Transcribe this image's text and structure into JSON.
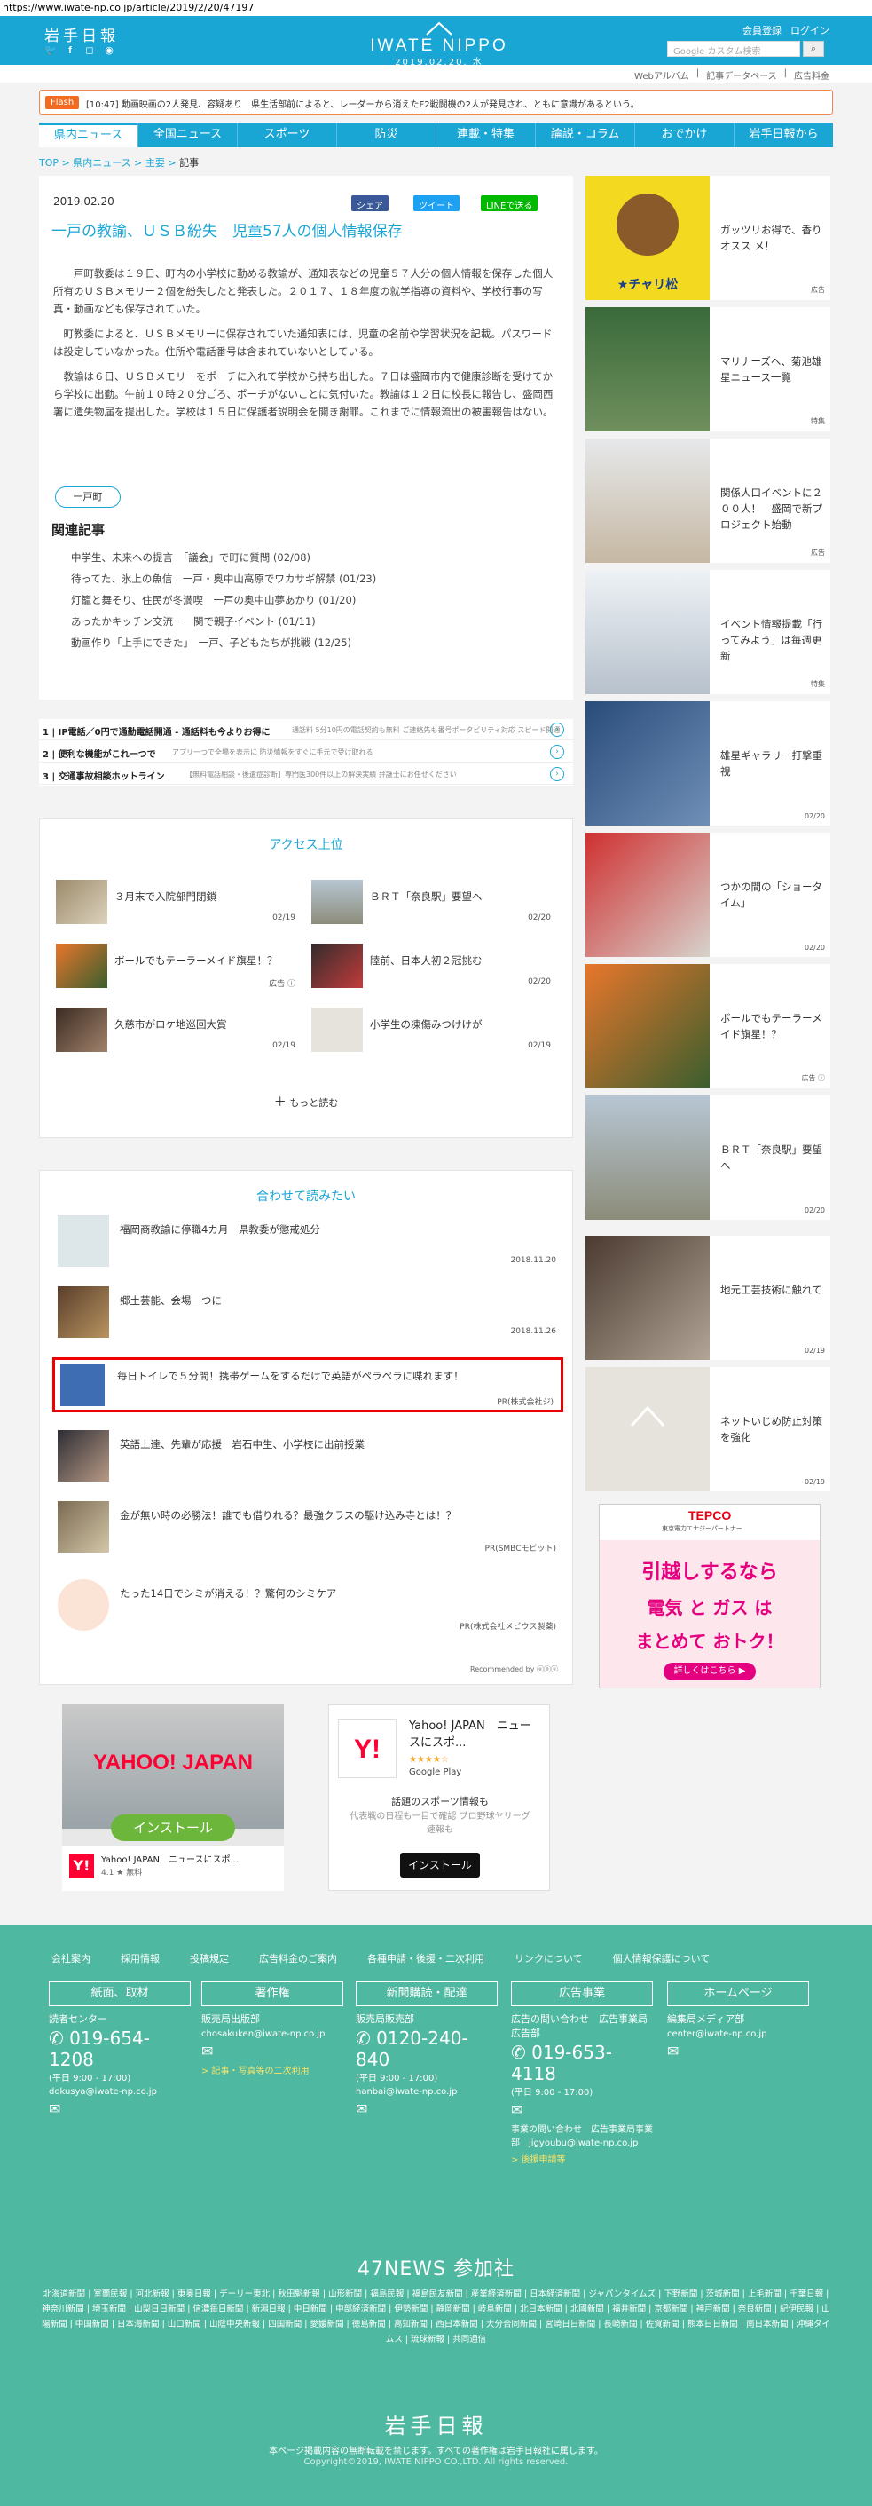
{
  "url": "https://www.iwate-np.co.jp/article/2019/2/20/47197",
  "header": {
    "logo_jp": "岩手日報",
    "brand": "IWATE NIPPO",
    "date": "2019.02.20. 水",
    "links": [
      "会員登録",
      "ログイン"
    ],
    "search_placeholder": "Google カスタム検索",
    "sub_links": [
      "Webアルバム",
      "記事データベース",
      "広告料金"
    ]
  },
  "flash": {
    "label": "Flash",
    "text": "[10:47] 動画映画の2人発見、容疑あり　県生活部前によると、レーダーから消えたF2戦闘機の2人が発見され、ともに意識があるという。"
  },
  "nav": [
    "県内ニュース",
    "全国ニュース",
    "スポーツ",
    "防災",
    "連載・特集",
    "論説・コラム",
    "おでかけ",
    "岩手日報から"
  ],
  "breadcrumb": [
    "TOP",
    "県内ニュース",
    "主要",
    "記事"
  ],
  "article": {
    "date": "2019.02.20",
    "share": [
      "シェア",
      "ツイート",
      "LINEで送る"
    ],
    "title": "一戸の教諭、ＵＳＢ紛失　児童57人の個人情報保存",
    "paragraphs": [
      "一戸町教委は１９日、町内の小学校に勤める教諭が、通知表などの児童５７人分の個人情報を保存した個人所有のＵＳＢメモリー２個を紛失したと発表した。２０１７、１８年度の就学指導の資料や、学校行事の写真・動画なども保存されていた。",
      "町教委によると、ＵＳＢメモリーに保存されていた通知表には、児童の名前や学習状況を記載。パスワードは設定していなかった。住所や電話番号は含まれていないとしている。",
      "教諭は６日、ＵＳＢメモリーをポーチに入れて学校から持ち出した。７日は盛岡市内で健康診断を受けてから学校に出勤。午前１０時２０分ごろ、ポーチがないことに気付いた。教諭は１２日に校長に報告し、盛岡西署に遺失物届を提出した。学校は１５日に保護者説明会を開き謝罪。これまでに情報流出の被害報告はない。"
    ],
    "tag": "一戸町",
    "related_heading": "関連記事",
    "related": [
      "中学生、未来への提言　「議会」で町に質問 (02/08)",
      "待ってた、氷上の魚信　一戸・奥中山高原でワカサギ解禁 (01/23)",
      "灯籠と舞そり、住民が冬満喫　一戸の奥中山夢あかり (01/20)",
      "あったかキッチン交流　一関で親子イベント (01/11)",
      "動画作り「上手にできた」　一戸、子どもたちが挑戦 (12/25)"
    ]
  },
  "ads_text": [
    {
      "num": "1",
      "title": "IP電話／0円で通勤電話開通 - 通話料も今よりお得に",
      "desc": "通話料 5分10円の電話契約も無料 ご連絡先も番号ポータビリティ対応 スピード開通"
    },
    {
      "num": "2",
      "title": "便利な機能がこれ一つで",
      "desc": "アプリ一つで全場を表示に 防災情報をすぐに手元で受け取れる"
    },
    {
      "num": "3",
      "title": "交通事故相談ホットライン",
      "desc": "【無料電話相談・後遺症診断】専門医300件以上の解決実績 弁護士にお任せください"
    }
  ],
  "ranking": {
    "heading": "アクセス上位",
    "items": [
      {
        "title": "３月末で入院部門閉鎖",
        "date": "02/19"
      },
      {
        "title": "ＢＲＴ「奈良駅」要望へ",
        "date": "02/20"
      },
      {
        "title": "ボールでもテーラーメイド旗星！？",
        "date": "広告 ⓘ"
      },
      {
        "title": "陸前、日本人初２冠挑む",
        "date": "02/20"
      },
      {
        "title": "久慈市がロケ地巡回大賞",
        "date": "02/19"
      },
      {
        "title": "小学生の凍傷みつけけが",
        "date": "02/19"
      }
    ],
    "more": "もっと読む"
  },
  "recommend": {
    "heading": "合わせて読みたい",
    "items": [
      {
        "title": "福岡商教諭に停職4カ月　県教委が懲戒処分",
        "date": "2018.11.20"
      },
      {
        "title": "郷土芸能、会場一つに",
        "date": "2018.11.26"
      },
      {
        "title": "毎日トイレで５分間！携帯ゲームをするだけで英語がペラペラに喋れます！",
        "date": "PR(株式会社ジ)"
      },
      {
        "title": "英語上達、先輩が応援　岩石中生、小学校に出前授業",
        "date": ""
      },
      {
        "title": "金が無い時の必勝法！誰でも借りれる？最強クラスの駆け込み寺とは！？",
        "date": "PR(SMBCモビット)"
      },
      {
        "title": "たった14日でシミが消える！？驚何のシミケア",
        "date": "PR(株式会社メビウス製薬)"
      }
    ],
    "by": "Recommended by ⓤⓞⓤ"
  },
  "bottom_ads": {
    "ad1_brand": "YAHOO! JAPAN",
    "ad1_button": "インストール",
    "ad1_app": "Yahoo! JAPAN　ニュースにスポ...",
    "ad1_rating": "4.1 ★ 無料",
    "ad2_title": "Yahoo! JAPAN　ニュースにスポ...",
    "ad2_store": "Google Play",
    "ad2_desc": "話題のスポーツ情報も",
    "ad2_sub": "代表戦の日程も一目で確認 ブロ野球ヤリーグ速報も",
    "ad2_button": "インストール"
  },
  "sidebar": {
    "items": [
      {
        "title": "ガッツリお得で、香りオスス メ！",
        "label": "広告"
      },
      {
        "title": "マリナーズへ、菊池雄星ニュース一覧",
        "label": "特集"
      },
      {
        "title": "関係人口イベントに２００人！　盛岡で新プロジェクト始動",
        "label": "広告"
      },
      {
        "title": "イベント情報提載「行ってみよう」は毎週更新",
        "label": "特集"
      },
      {
        "title": "雄星ギャラリー打撃重視",
        "label": "02/20"
      },
      {
        "title": "つかの間の「ショータイム」",
        "label": "02/20"
      },
      {
        "title": "ボールでもテーラーメイド旗星！？",
        "label": "広告 ⓘ"
      },
      {
        "title": "ＢＲＴ「奈良駅」要望へ",
        "label": "02/20"
      },
      {
        "title": "地元工芸技術に触れて",
        "label": "02/19"
      },
      {
        "title": "ネットいじめ防止対策を強化",
        "label": "02/19"
      }
    ],
    "ad": {
      "brand": "TEPCO",
      "brand_sub": "東京電力エナジーパートナー",
      "line1": "引越しするなら",
      "line2": "電気 と ガス は",
      "line3": "まとめて おトク！",
      "button": "詳しくはこちら ▶"
    },
    "cheap_brand": "★チャリ松"
  },
  "footer": {
    "links": [
      "会社案内",
      "採用情報",
      "投稿規定",
      "広告料金のご案内",
      "各種申請・後援・二次利用",
      "リンクについて",
      "個人情報保護について"
    ],
    "cols": [
      {
        "head": "紙面、取材",
        "label": "読者センター",
        "phone": "019-654-1208",
        "hours": "(平日 9:00 - 17:00)",
        "email": "dokusya@iwate-np.co.jp",
        "link": ""
      },
      {
        "head": "著作権",
        "label": "販売局出版部",
        "phone": "",
        "hours": "",
        "email": "chosakuken@iwate-np.co.jp",
        "link": "> 記事・写真等の二次利用"
      },
      {
        "head": "新聞購読・配達",
        "label": "販売局販売部",
        "phone": "0120-240-840",
        "hours": "(平日 9:00 - 17:00)",
        "email": "hanbai@iwate-np.co.jp",
        "link": ""
      },
      {
        "head": "広告事業",
        "label": "広告の問い合わせ　広告事業局広告部",
        "phone": "019-653-4118",
        "hours": "(平日 9:00 - 17:00)",
        "email": "事業の問い合わせ　広告事業局事業部　jigyoubu@iwate-np.co.jp",
        "link": "> 後援申請等"
      },
      {
        "head": "ホームページ",
        "label": "編集局メディア部",
        "phone": "",
        "hours": "",
        "email": "center@iwate-np.co.jp",
        "link": ""
      }
    ],
    "news_heading": "47NEWS 参加社",
    "news_members": "北海道新聞 | 室蘭民報 | 河北新報 | 東奥日報 | デーリー東北 | 秋田魁新報 | 山形新聞 | 福島民報 | 福島民友新聞 | 産業経済新聞 | 日本経済新聞 | ジャパンタイムズ | 下野新聞 | 茨城新聞 | 上毛新聞 | 千葉日報 | 神奈川新聞 | 埼玉新聞 | 山梨日日新聞 | 信濃毎日新聞 | 新潟日報 | 中日新聞 | 中部経済新聞 | 伊勢新聞 | 静岡新聞 | 岐阜新聞 | 北日本新聞 | 北國新聞 | 福井新聞 | 京都新聞 | 神戸新聞 | 奈良新聞 | 紀伊民報 | 山陽新聞 | 中国新聞 | 日本海新聞 | 山口新聞 | 山陰中央新報 | 四国新聞 | 愛媛新聞 | 徳島新聞 | 高知新聞 | 西日本新聞 | 大分合同新聞 | 宮崎日日新聞 | 長崎新聞 | 佐賀新聞 | 熊本日日新聞 | 南日本新聞 | 沖縄タイムス | 琉球新報 | 共同通信",
    "logo": "岩手日報",
    "note": "本ページ掲載内容の無断転載を禁じます。すべての著作権は岩手日報社に属します。",
    "copyright": "Copyright©2019, IWATE NIPPO CO.,LTD. All rights reserved."
  },
  "colors": {
    "brand": "#1aa6d5",
    "footer": "#4fb8a0",
    "flash": "#f26b21",
    "highlight": "#e00000"
  }
}
